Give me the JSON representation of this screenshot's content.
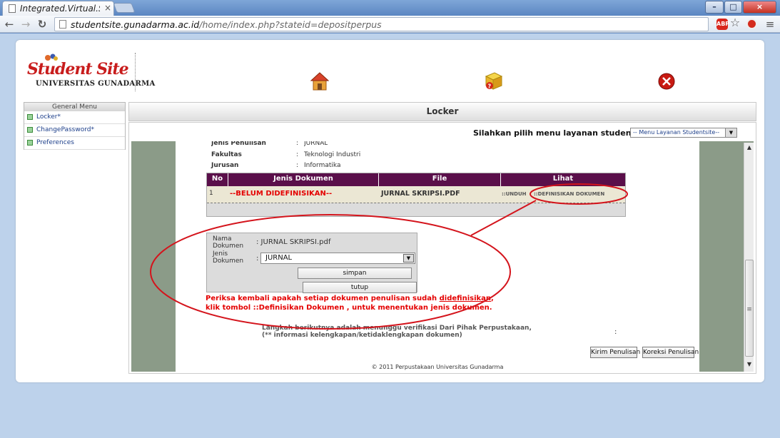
{
  "browser": {
    "tab_title": "Integrated.Virtual.Sysi",
    "tab_close": "×",
    "url_host": "studentsite.gunadarma.ac.id",
    "url_path": "/home/index.php?stateid=depositperpus",
    "back": "←",
    "forward": "→",
    "reload": "↻",
    "win_min": "–",
    "win_max": "□",
    "win_close": "×",
    "ext_badge": "ABP",
    "star": "☆",
    "menu": "≡"
  },
  "logo": {
    "title": "Student Site",
    "subtitle": "UNIVERSITAS GUNADARMA"
  },
  "general_menu": {
    "header": "General Menu",
    "items": [
      {
        "label": "Locker*"
      },
      {
        "label": "ChangePassword*"
      },
      {
        "label": "Preferences"
      }
    ]
  },
  "main": {
    "section_title": "Locker",
    "service_prompt": "Silahkan pilih menu layanan studentsite :",
    "service_select_value": "-- Menu Layanan Studentsite--",
    "info": [
      {
        "label": "Jenis Penulisan",
        "sep": ":",
        "value": "JURNAL"
      },
      {
        "label": "Fakultas",
        "sep": ":",
        "value": "Teknologi Industri"
      },
      {
        "label": "Jurusan",
        "sep": ":",
        "value": "Informatika"
      }
    ],
    "table": {
      "headers": [
        "No",
        "Jenis Dokumen",
        "File",
        "Lihat"
      ],
      "row": {
        "no": "1",
        "jenis": "--BELUM DIDEFINISIKAN--",
        "file": "JURNAL SKRIPSI.PDF",
        "unduh": "::UNDUH",
        "define": "::DEFINISIKAN DOKUMEN"
      }
    },
    "form": {
      "nama_label_1": "Nama",
      "nama_label_2": "Dokumen",
      "nama_value": ": JURNAL SKRIPSI.pdf",
      "jenis_label_1": "Jenis",
      "jenis_label_2": "Dokumen",
      "jenis_sep": ":",
      "jenis_value": "JURNAL",
      "simpan": "simpan",
      "tutup": "tutup"
    },
    "warning_line1_pre": "Periksa kembali apakah setiap dokumen penulisan sudah ",
    "warning_line1_link": "didefinisikan",
    "warning_line1_post": ",",
    "warning_line2": "klik tombol ::Definisikan Dokumen , untuk menentukan jenis dokumen.",
    "note_line1": "Langkah berikutnya adalah menunggu verifikasi Dari Pihak Perpustakaan,",
    "note_line2": "(** informasi kelengkapan/ketidaklengkapan dokumen)",
    "note_colon": ":",
    "btn_kirim": "Kirim Penulisan",
    "btn_koreksi": "Koreksi Penulisan",
    "footer": "© 2011 Perpustakaan Universitas Gunadarma"
  },
  "colors": {
    "table_header": "#5a0f4a",
    "warning": "#e40000",
    "annotation": "#d4141c"
  }
}
